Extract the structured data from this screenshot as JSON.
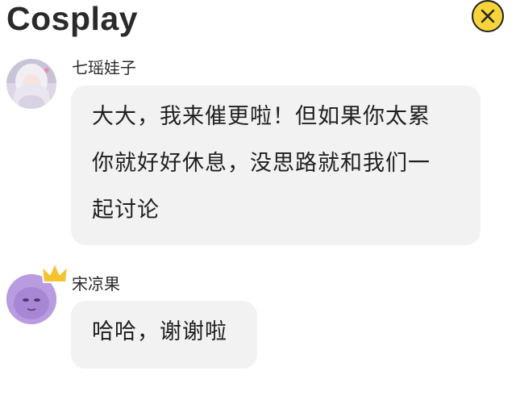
{
  "header": {
    "title": "Cosplay"
  },
  "messages": [
    {
      "user": "七瑶娃子",
      "lines": [
        "大大，我来催更啦！但如果你太累",
        "你就好好休息，没思路就和我们一",
        "起讨论"
      ]
    },
    {
      "user": "宋凉果",
      "lines": [
        "哈哈，谢谢啦"
      ]
    }
  ],
  "colors": {
    "close_button": "#f6d43a",
    "bubble": "#f2f2f2",
    "avatar2": "#b99be0",
    "crown": "#f4c430"
  },
  "icons": {
    "close": "close-icon",
    "crown": "crown-icon"
  }
}
